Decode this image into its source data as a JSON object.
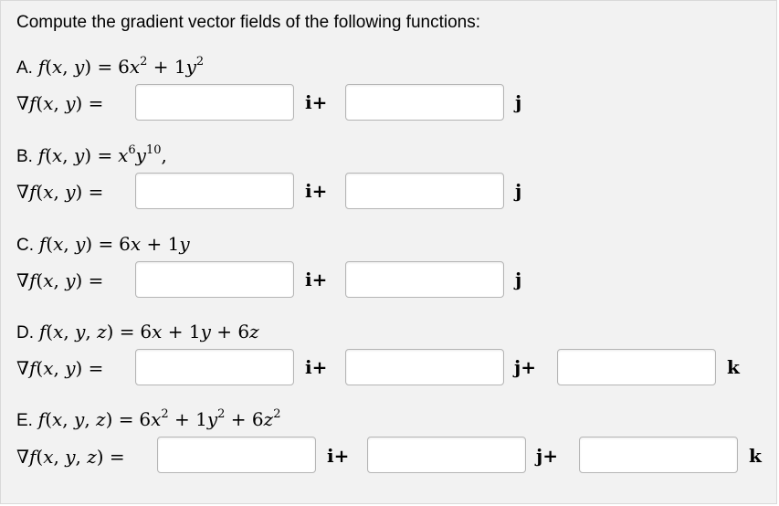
{
  "prompt": "Compute the gradient vector fields of the following functions:",
  "questions": [
    {
      "letter": "A.",
      "func_lhs": "f(x, y) =",
      "func_rhs_html": "6x² + 1y²",
      "grad_lhs": "∇f(x, y) =",
      "units": [
        "i+",
        "j"
      ]
    },
    {
      "letter": "B.",
      "func_lhs": "f(x, y) =",
      "func_rhs_html": "x⁶y¹⁰,",
      "grad_lhs": "∇f(x, y) =",
      "units": [
        "i+",
        "j"
      ]
    },
    {
      "letter": "C.",
      "func_lhs": "f(x, y) =",
      "func_rhs_html": "6x + 1y",
      "grad_lhs": "∇f(x, y) =",
      "units": [
        "i+",
        "j"
      ]
    },
    {
      "letter": "D.",
      "func_lhs": "f(x, y, z) =",
      "func_rhs_html": "6x + 1y + 6z",
      "grad_lhs": "∇f(x, y) =",
      "units": [
        "i+",
        "j+",
        "k"
      ]
    },
    {
      "letter": "E.",
      "func_lhs": "f(x, y, z) =",
      "func_rhs_html": "6x² + 1y² + 6z²",
      "grad_lhs": "∇f(x, y, z) =",
      "units": [
        "i+",
        "j+",
        "k"
      ]
    }
  ],
  "inputs": {
    "a_i": "",
    "a_j": "",
    "b_i": "",
    "b_j": "",
    "c_i": "",
    "c_j": "",
    "d_i": "",
    "d_j": "",
    "d_k": "",
    "e_i": "",
    "e_j": "",
    "e_k": ""
  }
}
